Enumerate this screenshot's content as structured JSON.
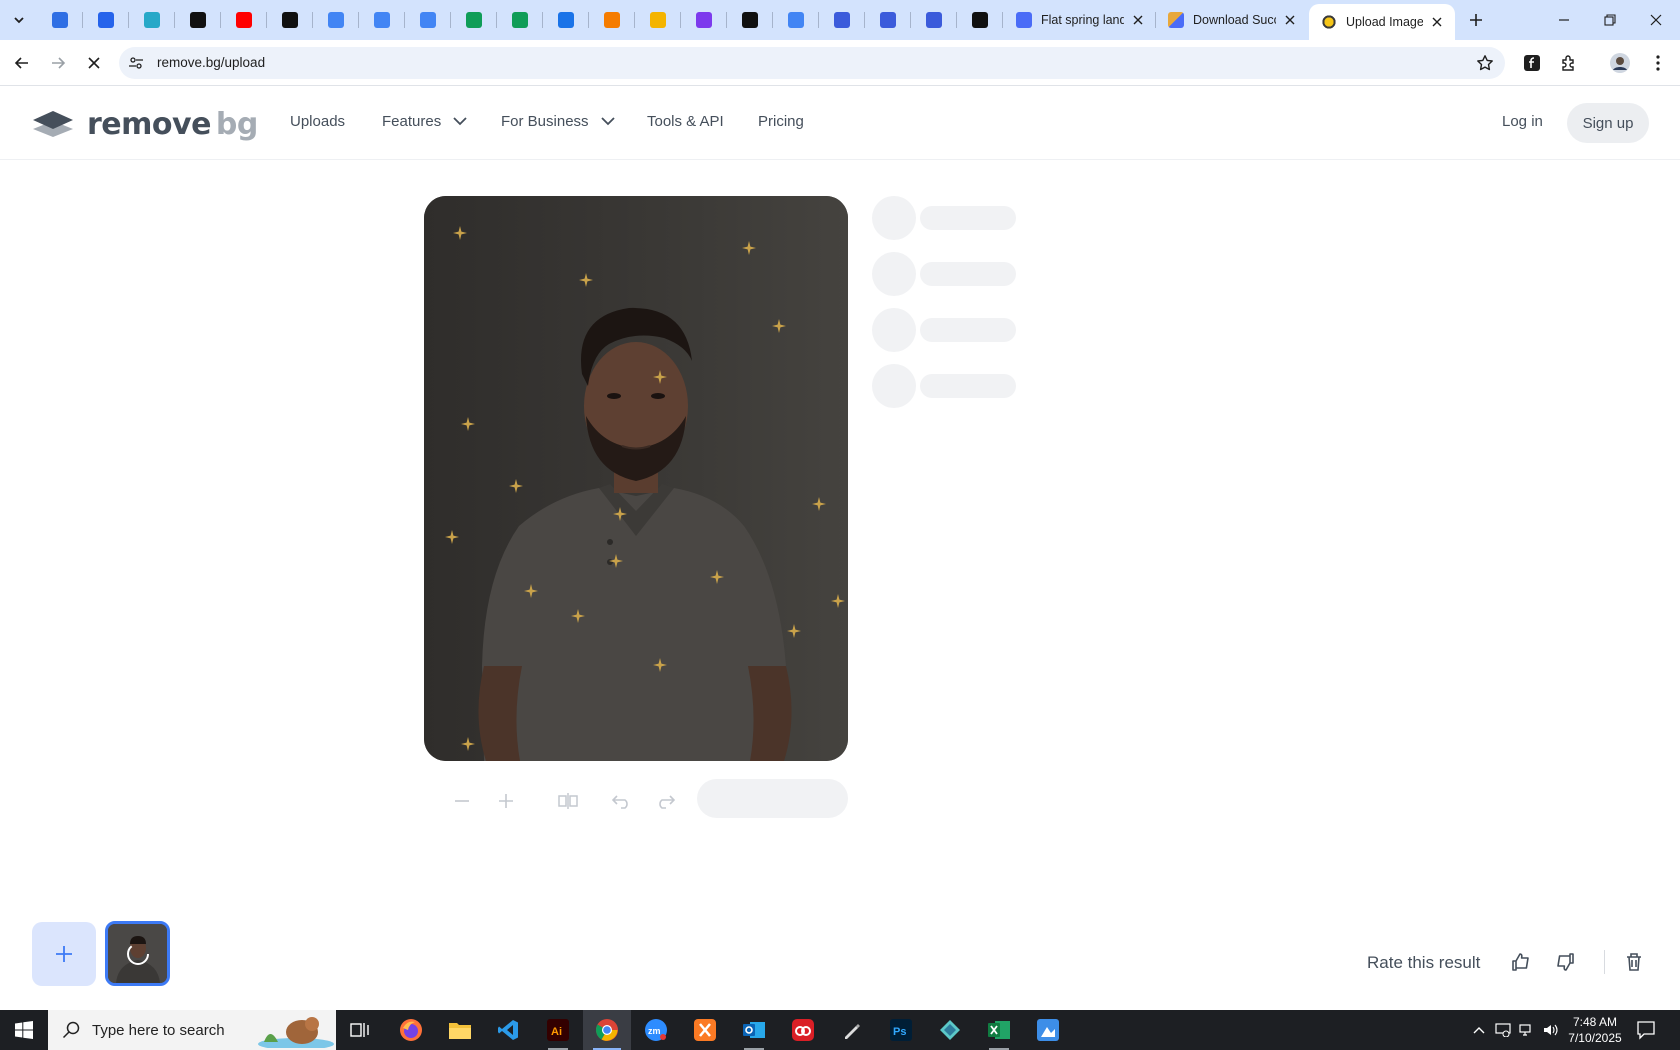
{
  "browser": {
    "tabs": [
      {
        "title": "Flat spring land",
        "favicon_color": "#4a6cf7"
      },
      {
        "title": "Download Succ",
        "favicon_color": "#e8a83b"
      },
      {
        "title": "Upload Image",
        "favicon_color": "#f5c518",
        "active": true
      }
    ],
    "pinned_tab_favicons": [
      "#2f6fe4",
      "#2563eb",
      "#26a8c8",
      "#111111",
      "#ff0000",
      "#111111",
      "#4285f4",
      "#4285f4",
      "#4285f4",
      "#0f9d58",
      "#0f9d58",
      "#1a73e8",
      "#f57c00",
      "#f4b400",
      "#7c3aed",
      "#111111",
      "#4285f4",
      "#3b5bdb",
      "#3b5bdb",
      "#3b5bdb",
      "#111111"
    ],
    "url": "remove.bg/upload"
  },
  "site": {
    "logo": {
      "word1": "remove",
      "word2": "bg"
    },
    "nav": {
      "uploads": "Uploads",
      "features": "Features",
      "for_business": "For Business",
      "tools_api": "Tools & API",
      "pricing": "Pricing"
    },
    "login": "Log in",
    "signup": "Sign up"
  },
  "footer": {
    "rate_label": "Rate this result"
  },
  "taskbar": {
    "search_placeholder": "Type here to search",
    "time": "7:48 AM",
    "date": "7/10/2025"
  },
  "colors": {
    "accent": "#3d7af5",
    "add_button_bg": "#dbe5fd",
    "text": "#454f5b",
    "skeleton": "#f1f2f4"
  }
}
